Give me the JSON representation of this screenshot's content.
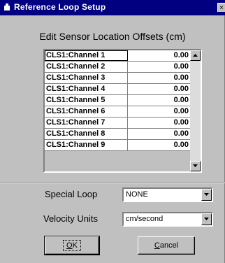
{
  "window": {
    "title": "Reference Loop Setup",
    "close_glyph": "×"
  },
  "heading": "Edit Sensor Location Offsets (cm)",
  "offsets_table": {
    "rows": [
      {
        "name": "CLS1:Channel 1",
        "value": "0.00"
      },
      {
        "name": "CLS1:Channel 2",
        "value": "0.00"
      },
      {
        "name": "CLS1:Channel 3",
        "value": "0.00"
      },
      {
        "name": "CLS1:Channel 4",
        "value": "0.00"
      },
      {
        "name": "CLS1:Channel 5",
        "value": "0.00"
      },
      {
        "name": "CLS1:Channel 6",
        "value": "0.00"
      },
      {
        "name": "CLS1:Channel 7",
        "value": "0.00"
      },
      {
        "name": "CLS1:Channel 8",
        "value": "0.00"
      },
      {
        "name": "CLS1:Channel 9",
        "value": "0.00"
      }
    ]
  },
  "special_loop": {
    "label": "Special Loop",
    "value": "NONE"
  },
  "velocity_units": {
    "label": "Velocity Units",
    "value": "cm/second"
  },
  "buttons": {
    "ok_mnemonic": "O",
    "ok_rest": "K",
    "cancel_mnemonic": "C",
    "cancel_rest": "ancel"
  }
}
